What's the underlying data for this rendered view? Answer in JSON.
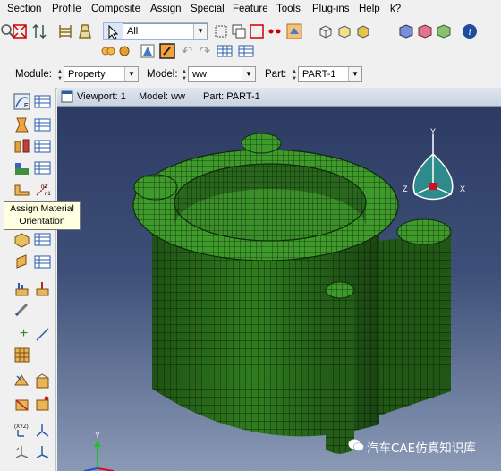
{
  "menu": {
    "items": [
      "Section",
      "Profile",
      "Composite",
      "Assign",
      "Special",
      "Feature",
      "Tools",
      "Plug-ins",
      "Help",
      "k?"
    ]
  },
  "toolbar": {
    "selection_filter": "All"
  },
  "context": {
    "module_label": "Module:",
    "module_value": "Property",
    "model_label": "Model:",
    "model_value": "ww",
    "part_label": "Part:",
    "part_value": "PART-1"
  },
  "tooltip": {
    "text": "Assign Material Orientation"
  },
  "viewport": {
    "title": "Viewport: 1",
    "model": "Model: ww",
    "part": "Part: PART-1"
  },
  "triad": {
    "top": {
      "y": "Y",
      "z": "Z",
      "x": "X"
    },
    "bottom": {
      "y": "Y"
    }
  },
  "watermark": {
    "text": "汽车CAE仿真知识库"
  },
  "colors": {
    "mesh_green": "#2f7d1f",
    "viewport_top": "#2c3b62",
    "viewport_bottom": "#8a9ab6",
    "triad_teal": "#2e8b8b"
  }
}
